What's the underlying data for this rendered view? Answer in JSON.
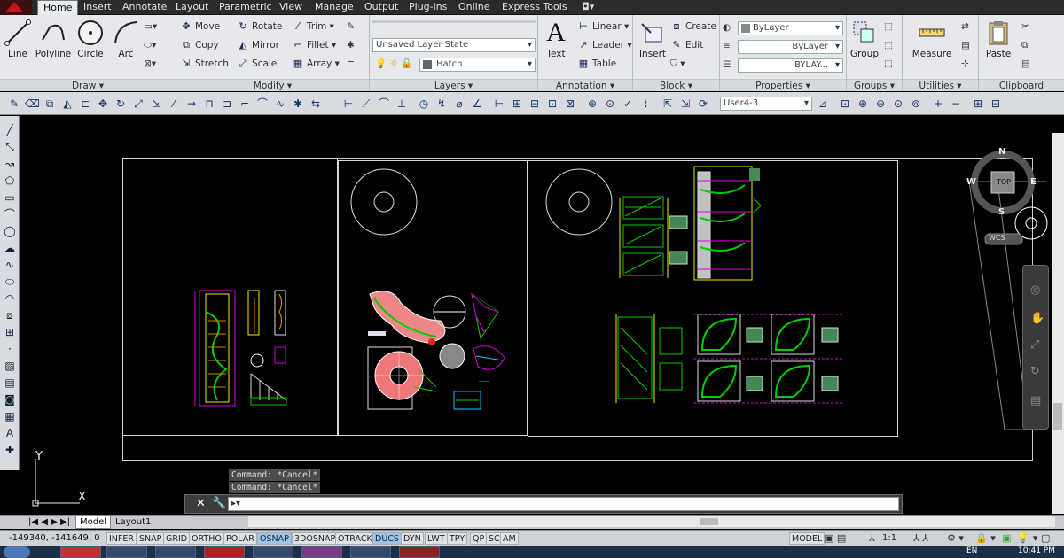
{
  "tabs": [
    "Home",
    "Insert",
    "Annotate",
    "Layout",
    "Parametric",
    "View",
    "Manage",
    "Output",
    "Plug-ins",
    "Online",
    "Express Tools"
  ],
  "active_tab": "Home",
  "draw": {
    "title": "Draw",
    "line": "Line",
    "polyline": "Polyline",
    "circle": "Circle",
    "arc": "Arc"
  },
  "modify": {
    "title": "Modify",
    "move": "Move",
    "rotate": "Rotate",
    "trim": "Trim",
    "copy": "Copy",
    "mirror": "Mirror",
    "fillet": "Fillet",
    "stretch": "Stretch",
    "scale": "Scale",
    "array": "Array"
  },
  "layers": {
    "title": "Layers",
    "state": "Unsaved Layer State",
    "hatch": "Hatch"
  },
  "annotation": {
    "title": "Annotation",
    "text": "Text",
    "linear": "Linear",
    "leader": "Leader",
    "table": "Table"
  },
  "block": {
    "title": "Block",
    "insert": "Insert",
    "create": "Create",
    "edit": "Edit"
  },
  "properties": {
    "title": "Properties",
    "color": "ByLayer",
    "linetype": "ByLayer",
    "lineweight": "BYLAY..."
  },
  "groups": {
    "title": "Groups",
    "group": "Group"
  },
  "utilities": {
    "title": "Utilities",
    "measure": "Measure"
  },
  "clipboard": {
    "title": "Clipboard",
    "paste": "Paste"
  },
  "workspace_dropdown": "User4-3",
  "viewcube": {
    "n": "N",
    "s": "S",
    "e": "E",
    "w": "W",
    "top": "TOP",
    "wcs": "WCS"
  },
  "ucs": {
    "x": "X",
    "y": "Y"
  },
  "command_history": [
    "Command: *Cancel*",
    "Command: *Cancel*"
  ],
  "layout_tabs": [
    "Model",
    "Layout1"
  ],
  "coordinates": "-149340, -141649, 0",
  "status_toggles": [
    {
      "label": "INFER",
      "on": false
    },
    {
      "label": "SNAP",
      "on": false
    },
    {
      "label": "GRID",
      "on": false
    },
    {
      "label": "ORTHO",
      "on": false
    },
    {
      "label": "POLAR",
      "on": false
    },
    {
      "label": "OSNAP",
      "on": true
    },
    {
      "label": "3DOSNAP",
      "on": false
    },
    {
      "label": "OTRACK",
      "on": false
    },
    {
      "label": "DUCS",
      "on": true
    },
    {
      "label": "DYN",
      "on": false
    },
    {
      "label": "LWT",
      "on": false
    },
    {
      "label": "TPY",
      "on": false
    },
    {
      "label": "QP",
      "on": false
    },
    {
      "label": "SC",
      "on": false
    },
    {
      "label": "AM",
      "on": false
    }
  ],
  "status_right": {
    "model": "MODEL",
    "scale": "1:1"
  },
  "clock": "10:41 PM",
  "lang": "EN"
}
